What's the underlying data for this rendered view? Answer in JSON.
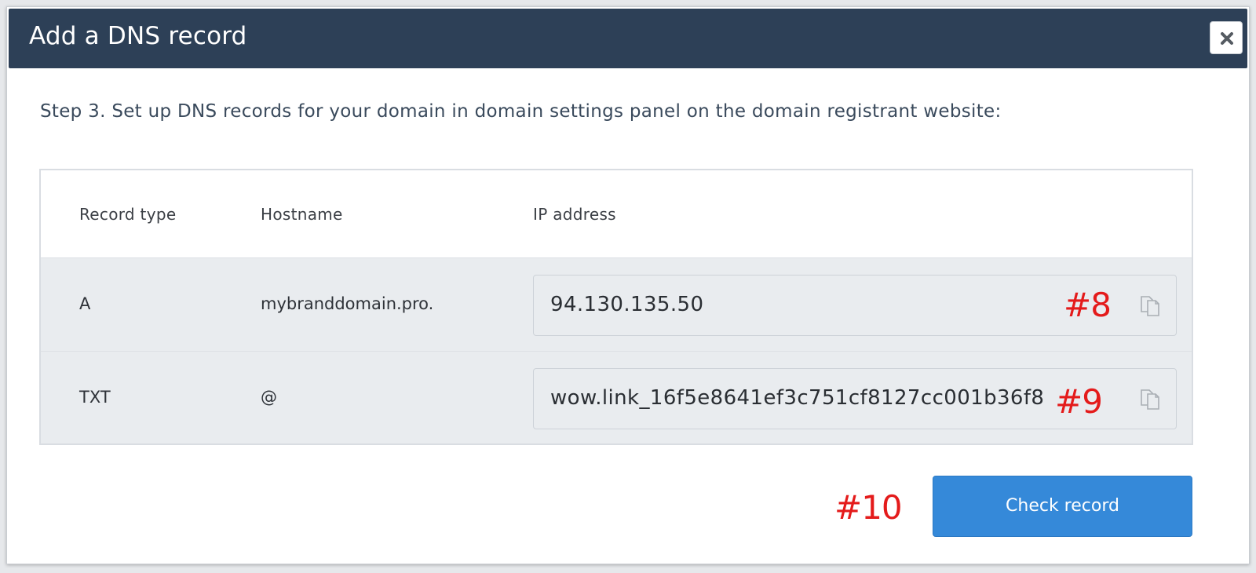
{
  "dialog": {
    "title": "Add a DNS record",
    "close_icon": "close-icon",
    "step_text": "Step 3. Set up DNS records for your domain in domain settings panel on the domain registrant website:"
  },
  "table": {
    "headers": [
      "Record type",
      "Hostname",
      "IP address"
    ],
    "rows": [
      {
        "type": "A",
        "hostname": "mybranddomain.pro.",
        "value": "94.130.135.50",
        "copy_icon": "copy-icon"
      },
      {
        "type": "TXT",
        "hostname": "@",
        "value": "wow.link_16f5e8641ef3c751cf8127cc001b36f8",
        "copy_icon": "copy-icon"
      }
    ]
  },
  "annotations": {
    "a8": "#8",
    "a9": "#9",
    "a10": "#10"
  },
  "actions": {
    "check_record": "Check record"
  },
  "colors": {
    "header_bg": "#2d4057",
    "primary_button": "#3589d9",
    "annotation_red": "#e41b1b"
  }
}
